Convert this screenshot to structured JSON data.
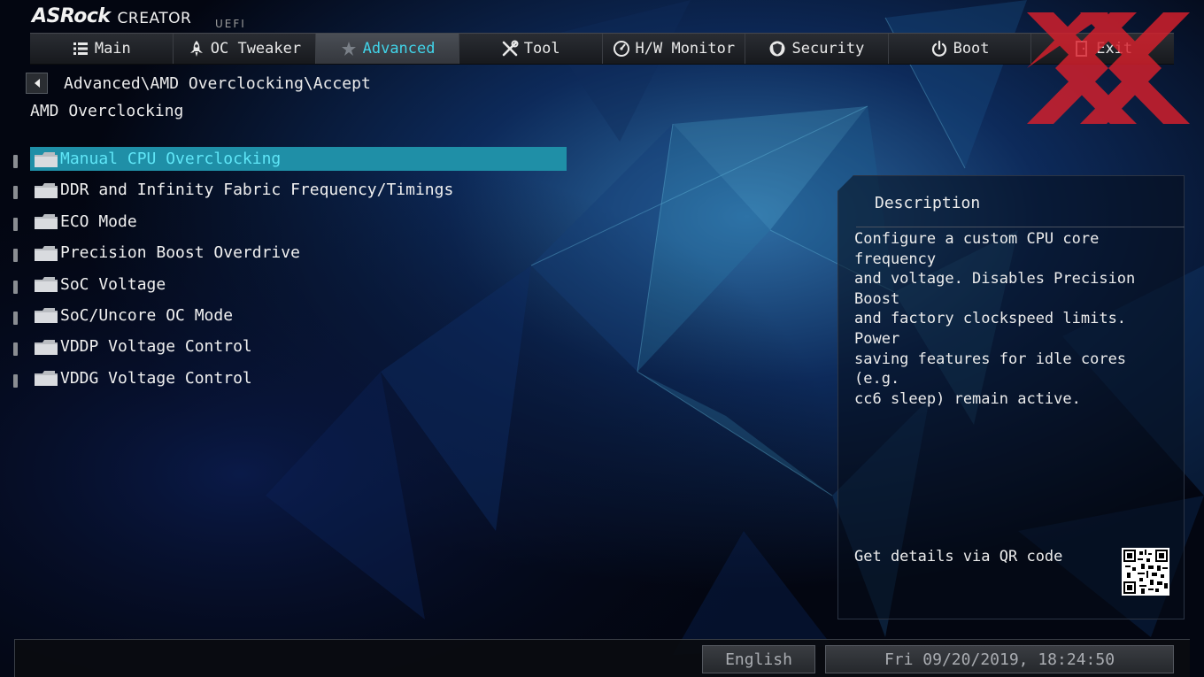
{
  "logo": {
    "brand": "ASRock",
    "series": "CREATOR",
    "firmware": "UEFI"
  },
  "tabs": [
    {
      "label": "Main",
      "icon": "list-icon",
      "active": false
    },
    {
      "label": "OC Tweaker",
      "icon": "rocket-icon",
      "active": false
    },
    {
      "label": "Advanced",
      "icon": "star-icon",
      "active": true
    },
    {
      "label": "Tool",
      "icon": "tools-icon",
      "active": false
    },
    {
      "label": "H/W Monitor",
      "icon": "gauge-icon",
      "active": false
    },
    {
      "label": "Security",
      "icon": "shield-icon",
      "active": false
    },
    {
      "label": "Boot",
      "icon": "power-icon",
      "active": false
    },
    {
      "label": "Exit",
      "icon": "exit-door-icon",
      "active": false
    }
  ],
  "breadcrumb": "Advanced\\AMD Overclocking\\Accept",
  "page_title": "AMD Overclocking",
  "menu": {
    "items": [
      {
        "label": "Manual CPU Overclocking",
        "selected": true
      },
      {
        "label": "DDR and Infinity Fabric Frequency/Timings",
        "selected": false
      },
      {
        "label": "ECO Mode",
        "selected": false
      },
      {
        "label": "Precision Boost Overdrive",
        "selected": false
      },
      {
        "label": "SoC Voltage",
        "selected": false
      },
      {
        "label": "SoC/Uncore OC Mode",
        "selected": false
      },
      {
        "label": "VDDP Voltage Control",
        "selected": false
      },
      {
        "label": "VDDG Voltage Control",
        "selected": false
      }
    ]
  },
  "description": {
    "title": "Description",
    "text": "Configure a custom CPU core frequency\nand voltage. Disables Precision Boost\nand factory clockspeed limits. Power\nsaving features for idle cores (e.g.\ncc6 sleep) remain active.",
    "qr_label": "Get details via QR code"
  },
  "status": {
    "language": "English",
    "datetime": "Fri 09/20/2019, 18:24:50"
  },
  "colors": {
    "accent": "#41d3e8",
    "selection": "#1f8fa7",
    "watermark": "#d8202c"
  }
}
